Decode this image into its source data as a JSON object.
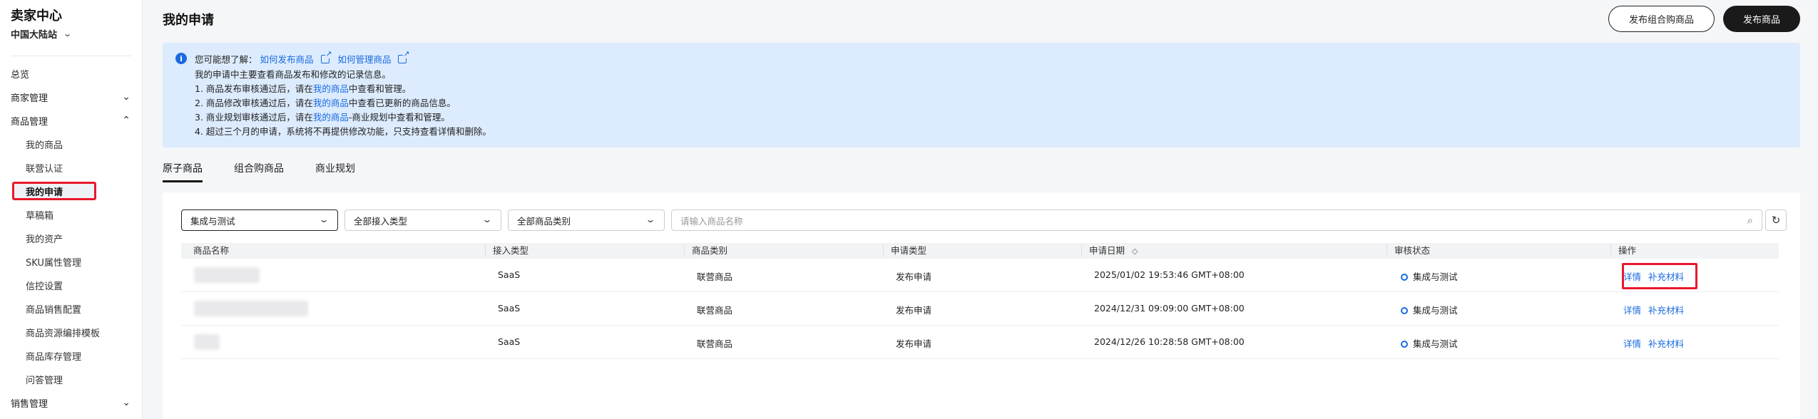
{
  "sidebar": {
    "brand": "卖家中心",
    "site": "中国大陆站",
    "items": [
      {
        "label": "总览",
        "type": "top"
      },
      {
        "label": "商家管理",
        "type": "group",
        "expanded": false
      },
      {
        "label": "商品管理",
        "type": "group",
        "expanded": true
      },
      {
        "label": "我的商品",
        "type": "sub"
      },
      {
        "label": "联营认证",
        "type": "sub"
      },
      {
        "label": "我的申请",
        "type": "sub",
        "active": true
      },
      {
        "label": "草稿箱",
        "type": "sub"
      },
      {
        "label": "我的资产",
        "type": "sub"
      },
      {
        "label": "SKU属性管理",
        "type": "sub"
      },
      {
        "label": "信控设置",
        "type": "sub"
      },
      {
        "label": "商品销售配置",
        "type": "sub"
      },
      {
        "label": "商品资源编排模板",
        "type": "sub"
      },
      {
        "label": "商品库存管理",
        "type": "sub"
      },
      {
        "label": "问答管理",
        "type": "sub"
      },
      {
        "label": "销售管理",
        "type": "group",
        "expanded": false
      }
    ]
  },
  "header": {
    "title": "我的申请",
    "btn_bundle": "发布组合购商品",
    "btn_publish": "发布商品"
  },
  "notice": {
    "prefix": "您可能想了解：",
    "link1": "如何发布商品",
    "link2": "如何管理商品",
    "l2": "我的申请中主要查看商品发布和修改的记录信息。",
    "l3a": "1. 商品发布审核通过后，请在",
    "l3b": "我的商品",
    "l3c": "中查看和管理。",
    "l4a": "2. 商品修改审核通过后，请在",
    "l4b": "我的商品",
    "l4c": "中查看已更新的商品信息。",
    "l5a": "3. 商业规划审核通过后，请在",
    "l5b": "我的商品",
    "l5c": "-商业规划中查看和管理。",
    "l6": "4. 超过三个月的申请，系统将不再提供修改功能，只支持查看详情和删除。"
  },
  "tabs": [
    "原子商品",
    "组合购商品",
    "商业规划"
  ],
  "filters": {
    "env": "集成与测试",
    "access_type": "全部接入类型",
    "category": "全部商品类别",
    "search_placeholder": "请输入商品名称"
  },
  "table": {
    "columns": [
      "商品名称",
      "接入类型",
      "商品类别",
      "申请类型",
      "申请日期",
      "审核状态",
      "操作"
    ],
    "rows": [
      {
        "access": "SaaS",
        "category": "联营商品",
        "apply_type": "发布申请",
        "date": "2025/01/02 19:53:46 GMT+08:00",
        "status": "集成与测试",
        "op1": "详情",
        "op2": "补充材料"
      },
      {
        "access": "SaaS",
        "category": "联营商品",
        "apply_type": "发布申请",
        "date": "2024/12/31 09:09:00 GMT+08:00",
        "status": "集成与测试",
        "op1": "详情",
        "op2": "补充材料"
      },
      {
        "access": "SaaS",
        "category": "联营商品",
        "apply_type": "发布申请",
        "date": "2024/12/26 10:28:58 GMT+08:00",
        "status": "集成与测试",
        "op1": "详情",
        "op2": "补充材料"
      }
    ]
  },
  "colors": {
    "accent": "#1a6be0",
    "highlight": "#e8192c",
    "notice_bg": "#dcebfd"
  },
  "icons": {
    "info": "info-icon",
    "external": "external-link-icon",
    "chevron": "chevron-down-icon",
    "search": "search-icon",
    "refresh": "refresh-icon",
    "sort": "sort-icon"
  }
}
